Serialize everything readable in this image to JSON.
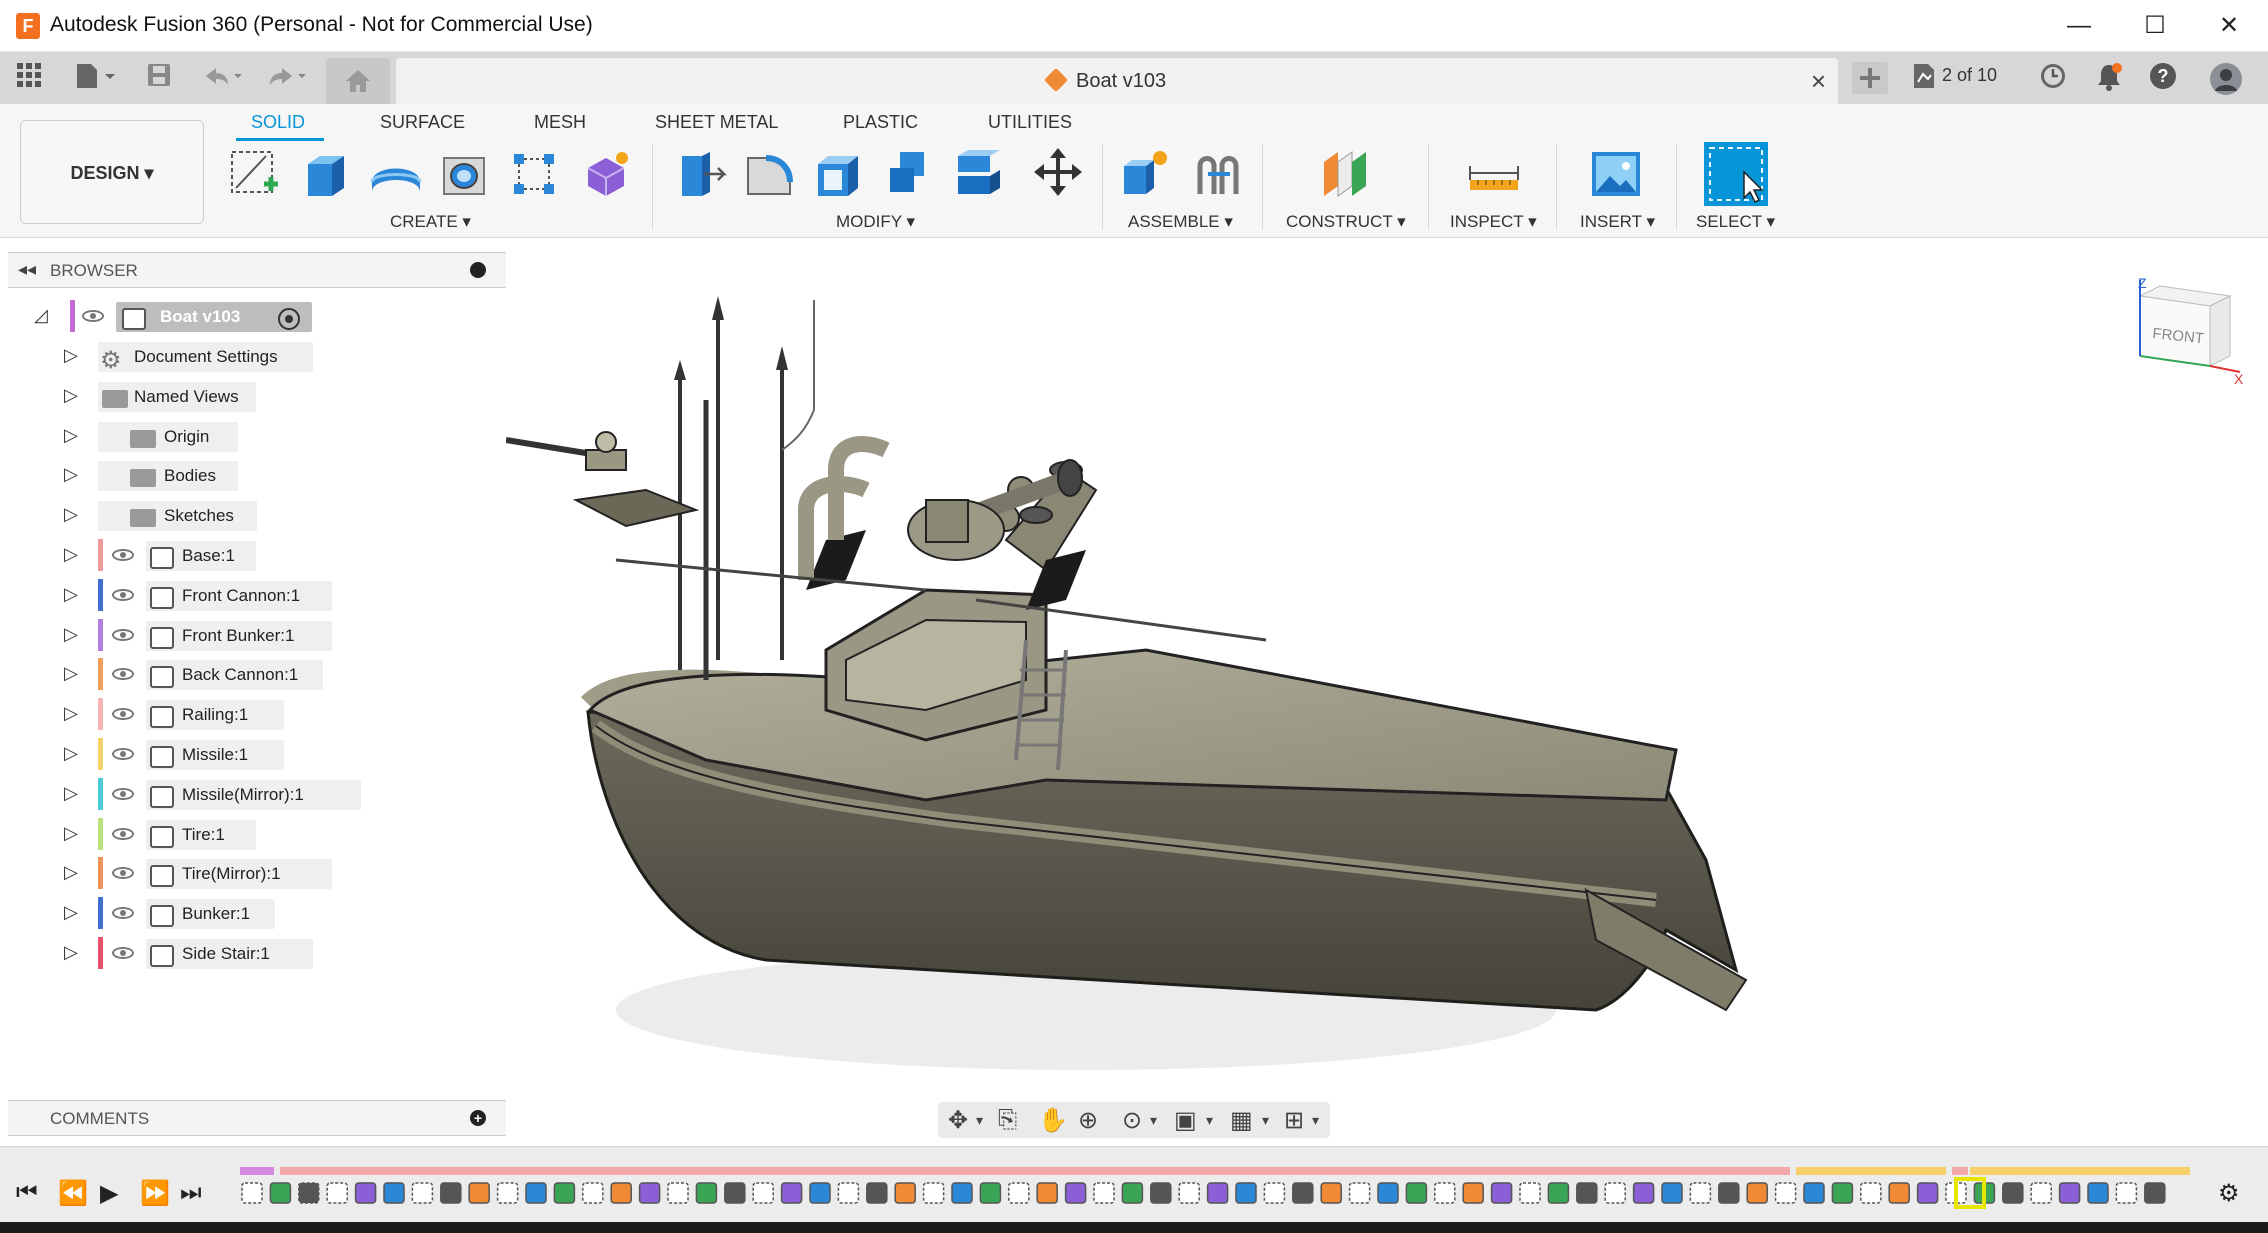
{
  "window": {
    "title": "Autodesk Fusion 360 (Personal - Not for Commercial Use)",
    "logo_letter": "F",
    "controls": {
      "minimize": "—",
      "maximize": "☐",
      "close": "✕"
    }
  },
  "tabbar": {
    "doc_tab": "Boat v103",
    "job_status": "2 of 10"
  },
  "ribbon": {
    "workspace": "DESIGN ▾",
    "tabs": [
      "SOLID",
      "SURFACE",
      "MESH",
      "SHEET METAL",
      "PLASTIC",
      "UTILITIES"
    ],
    "groups": {
      "create": "CREATE ▾",
      "modify": "MODIFY ▾",
      "assemble": "ASSEMBLE ▾",
      "construct": "CONSTRUCT ▾",
      "inspect": "INSPECT ▾",
      "insert": "INSERT ▾",
      "select": "SELECT ▾"
    }
  },
  "browser": {
    "header": "BROWSER",
    "root": "Boat v103",
    "items": [
      {
        "label": "Document Settings",
        "color": ""
      },
      {
        "label": "Named Views",
        "color": ""
      },
      {
        "label": "Origin",
        "color": ""
      },
      {
        "label": "Bodies",
        "color": ""
      },
      {
        "label": "Sketches",
        "color": ""
      },
      {
        "label": "Base:1",
        "color": "#f29b9b"
      },
      {
        "label": "Front Cannon:1",
        "color": "#3f6fd1"
      },
      {
        "label": "Front Bunker:1",
        "color": "#b07fe0"
      },
      {
        "label": "Back Cannon:1",
        "color": "#f0a05a"
      },
      {
        "label": "Railing:1",
        "color": "#f6b3b3"
      },
      {
        "label": "Missile:1",
        "color": "#f3d36a"
      },
      {
        "label": "Missile(Mirror):1",
        "color": "#4fc9d6"
      },
      {
        "label": "Tire:1",
        "color": "#b9e27a"
      },
      {
        "label": "Tire(Mirror):1",
        "color": "#f0935b"
      },
      {
        "label": "Bunker:1",
        "color": "#3f6fd1"
      },
      {
        "label": "Side Stair:1",
        "color": "#e8516a"
      }
    ]
  },
  "comments": {
    "header": "COMMENTS"
  },
  "viewcube": {
    "face": "FRONT",
    "axis_z": "Z",
    "axis_x": "X"
  },
  "colors": {
    "accent": "#0696d7",
    "orange": "#f37021",
    "timeline_pink": "#f2a8a8",
    "timeline_yellow": "#f7cf6b"
  }
}
